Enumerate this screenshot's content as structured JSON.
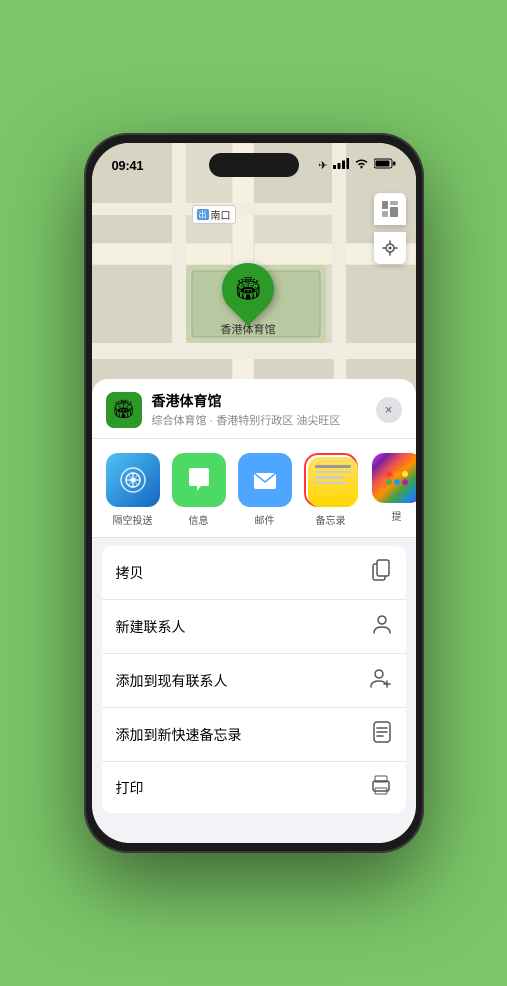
{
  "status": {
    "time": "09:41",
    "location_icon": "▶",
    "signal": "signal",
    "wifi": "wifi",
    "battery": "battery"
  },
  "map": {
    "label_nankou": "南口",
    "label_nankou_badge": "出",
    "venue_name_on_map": "香港体育馆"
  },
  "sheet": {
    "venue_name": "香港体育馆",
    "venue_subtitle": "综合体育馆 · 香港特别行政区 油尖旺区",
    "close_label": "×"
  },
  "share_items": [
    {
      "label": "隔空投送",
      "type": "airdrop"
    },
    {
      "label": "信息",
      "type": "message"
    },
    {
      "label": "邮件",
      "type": "mail"
    },
    {
      "label": "备忘录",
      "type": "notes"
    },
    {
      "label": "提",
      "type": "more"
    }
  ],
  "actions": [
    {
      "label": "拷贝",
      "icon": "copy"
    },
    {
      "label": "新建联系人",
      "icon": "person"
    },
    {
      "label": "添加到现有联系人",
      "icon": "person-add"
    },
    {
      "label": "添加到新快速备忘录",
      "icon": "note"
    },
    {
      "label": "打印",
      "icon": "print"
    }
  ]
}
